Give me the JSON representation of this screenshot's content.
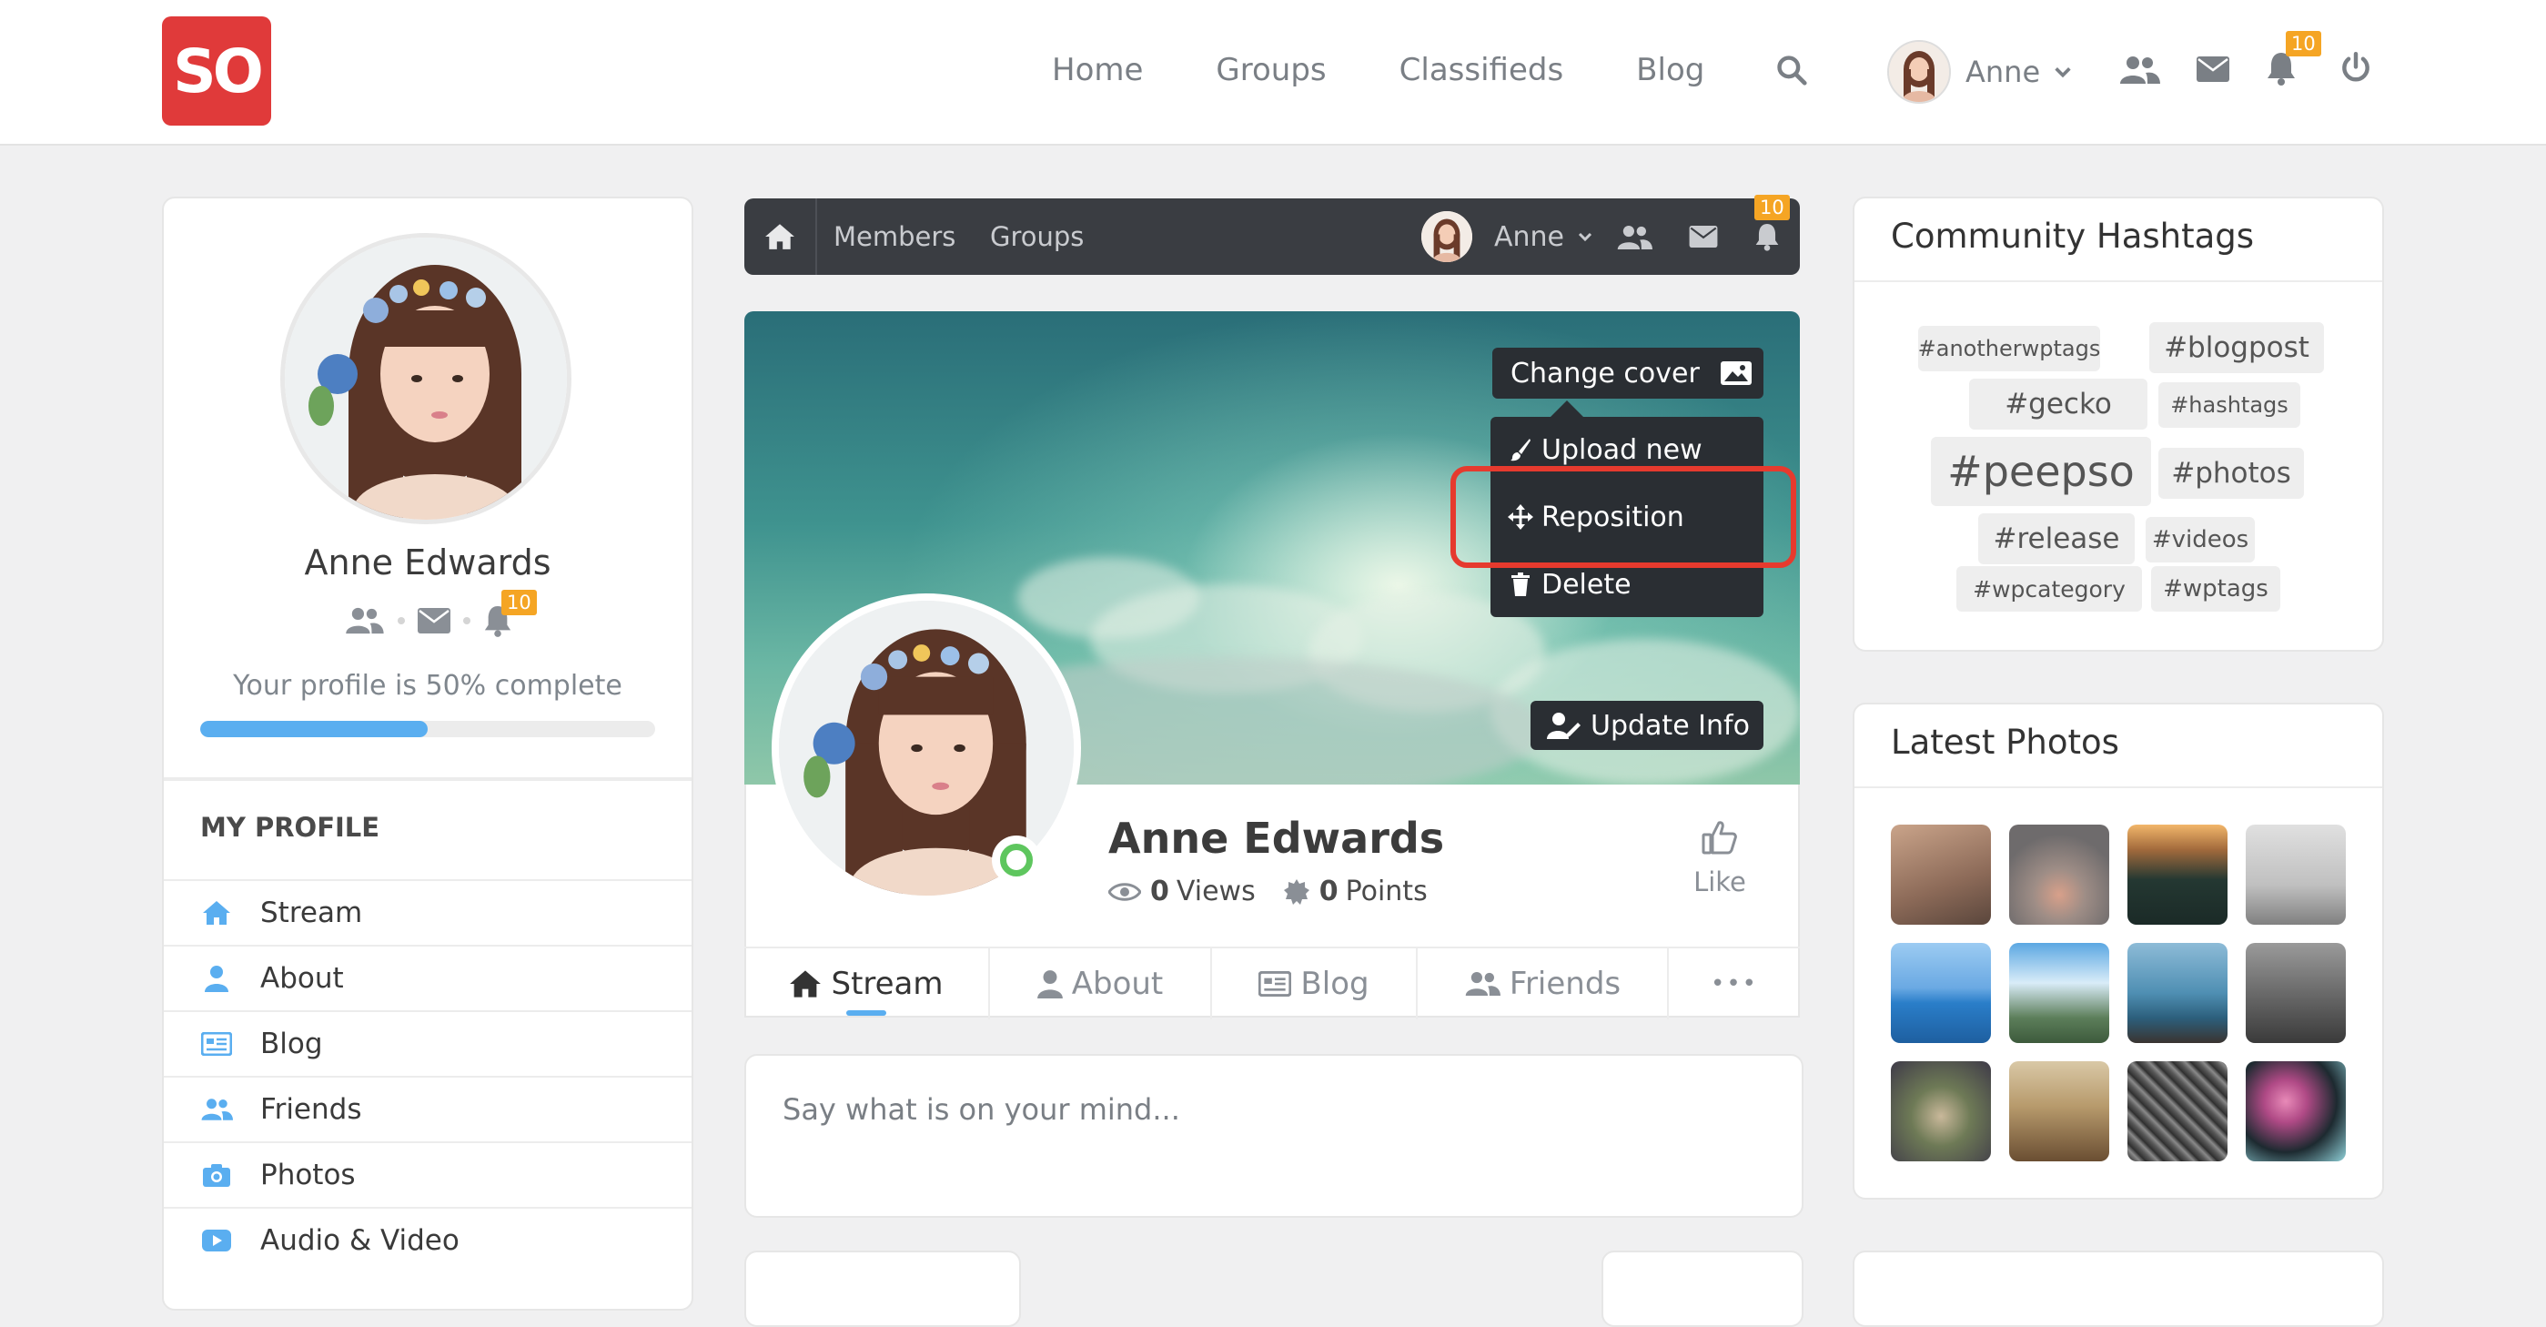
{
  "header": {
    "logo_text": "SO",
    "nav": [
      "Home",
      "Groups",
      "Classifieds",
      "Blog"
    ],
    "user_name": "Anne",
    "notification_count": "10"
  },
  "sidebar": {
    "profile_name": "Anne Edwards",
    "notification_count": "10",
    "profile_progress_text": "Your profile is 50% complete",
    "profile_progress_value": 50,
    "section_title": "MY PROFILE",
    "items": [
      {
        "label": "Stream",
        "icon": "home-icon"
      },
      {
        "label": "About",
        "icon": "user-icon"
      },
      {
        "label": "Blog",
        "icon": "blog-icon"
      },
      {
        "label": "Friends",
        "icon": "friends-icon"
      },
      {
        "label": "Photos",
        "icon": "camera-icon"
      },
      {
        "label": "Audio & Video",
        "icon": "video-icon"
      }
    ]
  },
  "subnav": {
    "links": [
      "Members",
      "Groups"
    ],
    "user_name": "Anne",
    "notification_count": "10"
  },
  "cover": {
    "change_cover_label": "Change cover",
    "menu": [
      "Upload new",
      "Reposition",
      "Delete"
    ],
    "update_info_label": "Update Info"
  },
  "profile": {
    "name": "Anne Edwards",
    "views_count": "0",
    "views_label": "Views",
    "points_count": "0",
    "points_label": "Points",
    "like_label": "Like"
  },
  "tabs": [
    "Stream",
    "About",
    "Blog",
    "Friends"
  ],
  "tabs_more": "•••",
  "post": {
    "placeholder": "Say what is on your mind..."
  },
  "hashtags": {
    "title": "Community Hashtags",
    "tags": [
      "#anotherwptags",
      "#blogpost",
      "#gecko",
      "#hashtags",
      "#peepso",
      "#photos",
      "#release",
      "#videos",
      "#wpcategory",
      "#wptags"
    ]
  },
  "photos": {
    "title": "Latest Photos"
  },
  "colors": {
    "accent": "#5aaef0",
    "brand": "#e03a3a",
    "badge": "#f5a524",
    "highlight": "#e63a2e",
    "online": "#5ec65e"
  }
}
